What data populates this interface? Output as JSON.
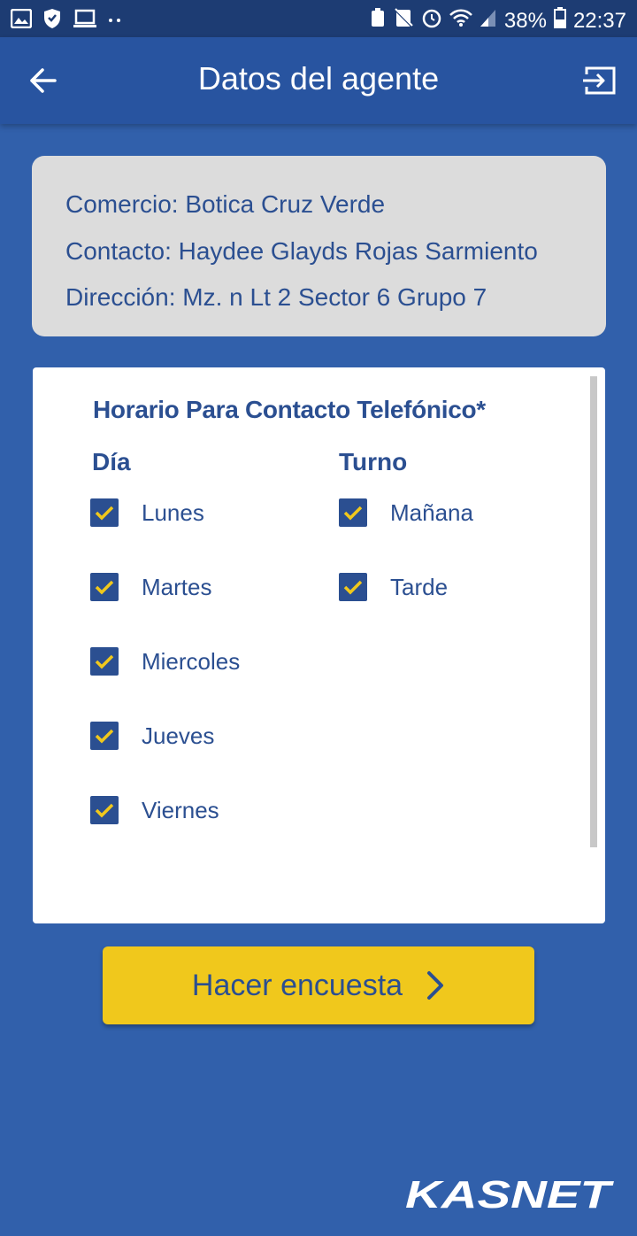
{
  "status_bar": {
    "battery": "38%",
    "time": "22:37"
  },
  "app_bar": {
    "title": "Datos del agente"
  },
  "info": {
    "comercio": "Comercio: Botica Cruz Verde",
    "contacto": "Contacto: Haydee Glayds Rojas Sarmiento",
    "direccion": "Dirección: Mz. n Lt 2 Sector 6 Grupo 7"
  },
  "schedule": {
    "title": "Horario Para Contacto Telefónico*",
    "day_header": "Día",
    "shift_header": "Turno",
    "days": [
      {
        "label": "Lunes",
        "checked": true
      },
      {
        "label": "Martes",
        "checked": true
      },
      {
        "label": "Miercoles",
        "checked": true
      },
      {
        "label": "Jueves",
        "checked": true
      },
      {
        "label": "Viernes",
        "checked": true
      }
    ],
    "shifts": [
      {
        "label": "Mañana",
        "checked": true
      },
      {
        "label": "Tarde",
        "checked": true
      }
    ]
  },
  "cta": {
    "label": "Hacer encuesta"
  },
  "logo": {
    "text": "KASNET"
  },
  "colors": {
    "background": "#3160ab",
    "app_bar": "#2854a0",
    "text_blue": "#2b4f91",
    "check_yellow": "#f0c81c",
    "button_yellow": "#f0c81c"
  }
}
